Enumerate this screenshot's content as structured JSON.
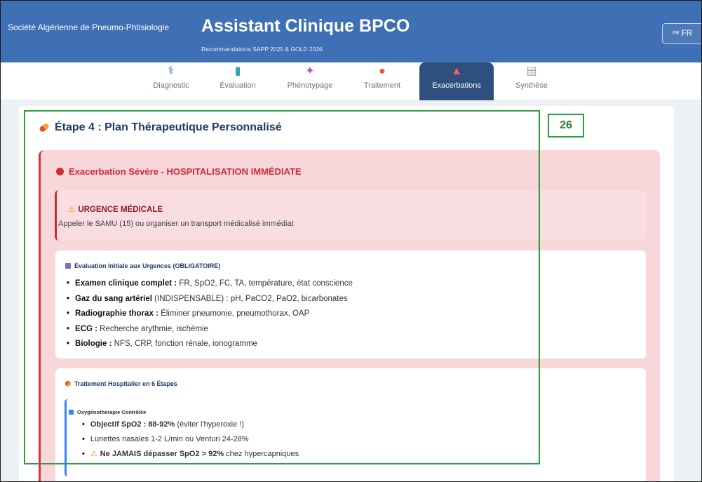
{
  "header": {
    "org": "Société Algérienne de Pneumo-Phtisiologie",
    "title": "Assistant Clinique BPCO",
    "subtitle": "Recommandations SAPP 2025 & GOLD 2026",
    "lang_flag": "FR",
    "lang_label": "FR"
  },
  "tabs": [
    {
      "label": "Diagnostic",
      "icon": "stethoscope-icon",
      "glyph": "⚕"
    },
    {
      "label": "Évaluation",
      "icon": "bar-chart-icon",
      "glyph": "▮"
    },
    {
      "label": "Phénotypage",
      "icon": "dna-icon",
      "glyph": "✦"
    },
    {
      "label": "Traitement",
      "icon": "pill-icon",
      "glyph": "●"
    },
    {
      "label": "Exacerbations",
      "icon": "siren-icon",
      "glyph": "▲",
      "active": true
    },
    {
      "label": "Synthèse",
      "icon": "clipboard-icon",
      "glyph": "▤"
    }
  ],
  "step": {
    "title": "Étape 4 : Plan Thérapeutique Personnalisé",
    "severity_title": "Exacerbation Sévère - HOSPITALISATION IMMÉDIATE",
    "urgent_title": "URGENCE MÉDICALE",
    "urgent_text": "Appeler le SAMU (15) ou organiser un transport médicalisé immédiat"
  },
  "eval_card": {
    "title": "Évaluation Initiale aux Urgences (OBLIGATOIRE)",
    "items": [
      {
        "bold": "Examen clinique complet :",
        "text": " FR, SpO2, FC, TA, température, état conscience"
      },
      {
        "bold": "Gaz du sang artériel",
        "text": " (INDISPENSABLE) : pH, PaCO2, PaO2, bicarbonates"
      },
      {
        "bold": "Radiographie thorax :",
        "text": " Éliminer pneumonie, pneumothorax, OAP"
      },
      {
        "bold": "ECG :",
        "text": " Recherche arythmie, ischémie"
      },
      {
        "bold": "Biologie :",
        "text": " NFS, CRP, fonction rénale, ionogramme"
      }
    ]
  },
  "treat_card": {
    "title": "Traitement Hospitalier en 6 Étapes",
    "sub_title": "Oxygénothérapie Contrôlée",
    "items": [
      {
        "bold": "Objectif SpO2 : 88-92%",
        "text": " (éviter l'hyperoxie !)"
      },
      {
        "bold": "",
        "text": "Lunettes nasales 1-2 L/min ou Venturi 24-28%"
      },
      {
        "bold": "Ne JAMAIS dépasser SpO2 > 92%",
        "text": " chez hypercapniques",
        "warn": true
      }
    ]
  },
  "annotation": {
    "badge": "26"
  },
  "colors": {
    "header": "#3f6fb5",
    "active_tab": "#2f4f7f",
    "danger": "#d12a37",
    "highlight": "#2e9e3e"
  }
}
